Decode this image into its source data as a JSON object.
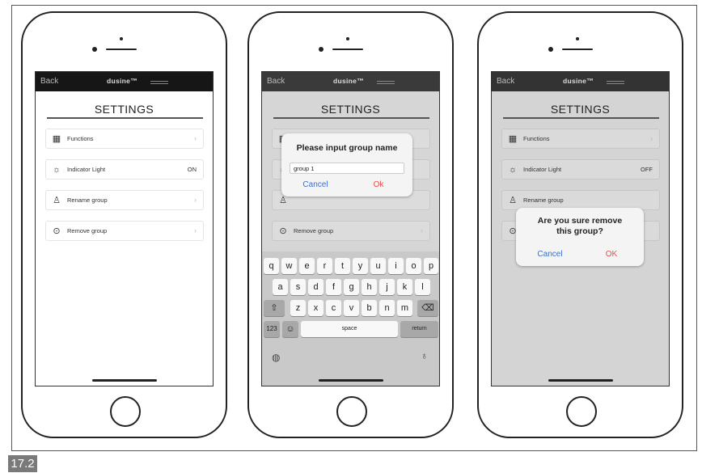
{
  "figure_label": "17.2",
  "app": {
    "back_label": "Back",
    "brand": "dusine™",
    "title": "SETTINGS"
  },
  "screens": [
    {
      "rows": [
        {
          "icon": "functions-icon",
          "label": "Functions",
          "value": ""
        },
        {
          "icon": "light-bulb-icon",
          "label": "Indicator Light",
          "value": "ON"
        },
        {
          "icon": "person-icon",
          "label": "Rename group",
          "value": ""
        },
        {
          "icon": "remove-circle-icon",
          "label": "Remove group",
          "value": ""
        }
      ]
    },
    {
      "dialog": {
        "title": "Please input group name",
        "input_value": "group 1",
        "cancel_label": "Cancel",
        "ok_label": "Ok"
      },
      "remove_row_label": "Remove group",
      "keyboard": {
        "row1": [
          "q",
          "w",
          "e",
          "r",
          "t",
          "y",
          "u",
          "i",
          "o",
          "p"
        ],
        "row2": [
          "a",
          "s",
          "d",
          "f",
          "g",
          "h",
          "j",
          "k",
          "l"
        ],
        "row3": [
          "z",
          "x",
          "c",
          "v",
          "b",
          "n",
          "m"
        ],
        "numbers_key": "123",
        "space_key": "space",
        "return_key": "return"
      }
    },
    {
      "rows": [
        {
          "label": "Functions",
          "value": ""
        },
        {
          "label": "Indicator Light",
          "value": "OFF"
        },
        {
          "label": "Rename group",
          "value": ""
        }
      ],
      "dialog": {
        "title_line1": "Are you sure remove",
        "title_line2": "this group?",
        "cancel_label": "Cancel",
        "ok_label": "OK"
      }
    }
  ]
}
